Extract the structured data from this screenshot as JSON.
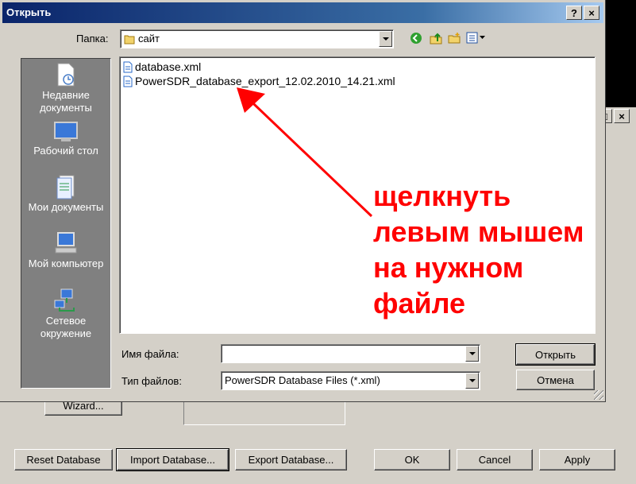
{
  "background_window": {
    "buttons": {
      "wizard": "Wizard...",
      "reset_database": "Reset Database",
      "import_database": "Import Database...",
      "export_database": "Export Database...",
      "ok": "OK",
      "cancel": "Cancel",
      "apply": "Apply"
    }
  },
  "dialog": {
    "title": "Открыть",
    "title_buttons": {
      "help": "?",
      "close": "×"
    },
    "folder_label": "Папка:",
    "folder_value": "сайт",
    "places": [
      {
        "label": "Недавние документы",
        "icon": "recent-documents-icon"
      },
      {
        "label": "Рабочий стол",
        "icon": "desktop-icon"
      },
      {
        "label": "Мои документы",
        "icon": "my-documents-icon"
      },
      {
        "label": "Мой компьютер",
        "icon": "my-computer-icon"
      },
      {
        "label": "Сетевое окружение",
        "icon": "network-icon"
      }
    ],
    "files": [
      {
        "name": "database.xml",
        "icon": "xml-file-icon"
      },
      {
        "name": "PowerSDR_database_export_12.02.2010_14.21.xml",
        "icon": "xml-file-icon"
      }
    ],
    "filename_label": "Имя файла:",
    "filename_value": "",
    "filetype_label": "Тип файлов:",
    "filetype_value": "PowerSDR Database Files (*.xml)",
    "open_button": "Открыть",
    "cancel_button": "Отмена"
  },
  "annotation": {
    "lines": [
      "щелкнуть",
      "левым мышем",
      "на нужном",
      "файле"
    ],
    "color": "#ff0000"
  },
  "colors": {
    "window_face": "#d4d0c8",
    "title_start": "#0a246a",
    "title_end": "#a6caf0",
    "places_bar": "#808080"
  }
}
